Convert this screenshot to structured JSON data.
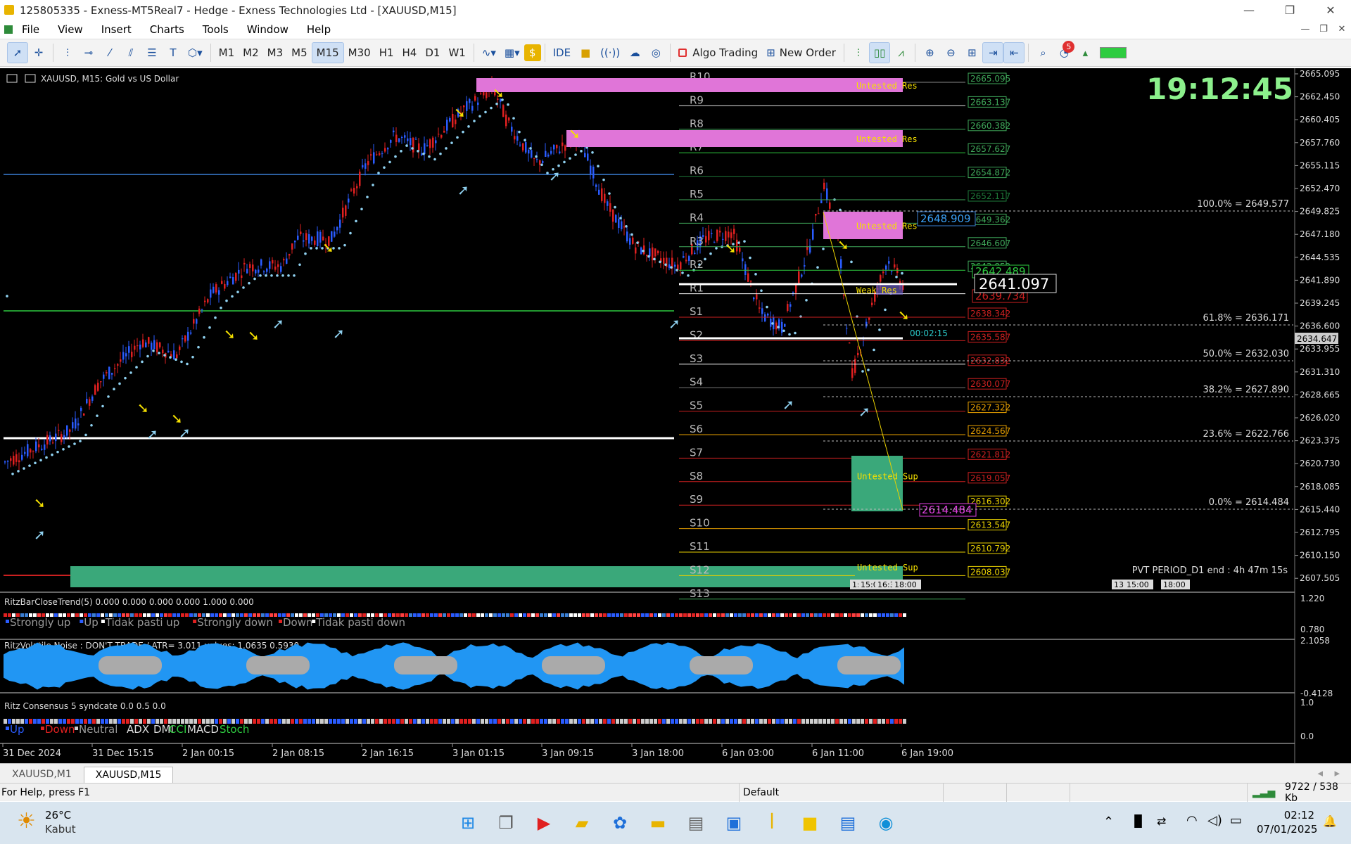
{
  "window": {
    "title": "125805335 - Exness-MT5Real7 - Hedge - Exness Technologies Ltd - [XAUUSD,M15]",
    "minimize": "—",
    "maximize": "❐",
    "close": "✕"
  },
  "menu": [
    "File",
    "View",
    "Insert",
    "Charts",
    "Tools",
    "Window",
    "Help"
  ],
  "toolbar": {
    "timeframes": [
      "M1",
      "M2",
      "M3",
      "M5",
      "M15",
      "M30",
      "H1",
      "H4",
      "D1",
      "W1"
    ],
    "active_timeframe": "M15",
    "ide": "IDE",
    "algo_trading": "Algo Trading",
    "new_order": "New Order",
    "notif_count": "5"
  },
  "chart": {
    "symbol_title": "XAUUSD, M15:  Gold vs US Dollar",
    "clock": "19:12:45",
    "current_price": "2641.097",
    "bid_price": "2634.647",
    "timer": "00:02:15",
    "price_labels": [
      "2665.095",
      "2663.137",
      "2660.382",
      "2657.627",
      "2654.872",
      "2652.117",
      "2649.362",
      "2646.607",
      "2643.852",
      "2641.097",
      "2638.342",
      "2635.587",
      "2632.832",
      "2630.077",
      "2627.322",
      "2624.567",
      "2621.812",
      "2619.057",
      "2616.302",
      "2613.547",
      "2610.792",
      "2608.037"
    ],
    "axis_prices": [
      "2665.095",
      "2662.450",
      "2660.405",
      "2657.760",
      "2655.115",
      "2652.470",
      "2649.825",
      "2647.180",
      "2644.535",
      "2641.890",
      "2639.245",
      "2636.600",
      "2633.955",
      "2631.310",
      "2628.665",
      "2626.020",
      "2623.375",
      "2620.730",
      "2618.085",
      "2615.440",
      "2612.795",
      "2610.150",
      "2607.505"
    ],
    "axis_highlight": "2634.647",
    "pivot_names": [
      "R10",
      "R9",
      "R8",
      "R7",
      "R6",
      "R5",
      "R4",
      "R3",
      "R2",
      "R1",
      "S1",
      "S2",
      "S3",
      "S4",
      "S5",
      "S6",
      "S7",
      "S8",
      "S9",
      "S10",
      "S11",
      "S12",
      "S13"
    ],
    "zones": [
      "Untested Res",
      "Untested Res",
      "Untested Res",
      "Weak Res",
      "Untested Sup",
      "Untested Sup"
    ],
    "labels": {
      "high": "2648.909",
      "mid": "2642.489",
      "lowred": "2639.734",
      "low": "2614.484"
    },
    "fib": [
      "100.0% = 2649.577",
      "61.8% = 2636.171",
      "50.0% = 2632.030",
      "38.2% = 2627.890",
      "23.6% = 2622.766",
      "0.0% = 2614.484"
    ],
    "pvt": "PVT PERIOD_D1 end : 4h 47m 15s",
    "time_tags": [
      "1:",
      "15:00",
      "16:3",
      "18:00",
      "13:3",
      "15:00",
      "18:00"
    ],
    "x_axis": [
      "31 Dec 2024",
      "31 Dec 15:15",
      "2 Jan 00:15",
      "2 Jan 08:15",
      "2 Jan 16:15",
      "3 Jan 01:15",
      "3 Jan 09:15",
      "3 Jan 18:00",
      "6 Jan 03:00",
      "6 Jan 11:00",
      "6 Jan 19:00"
    ]
  },
  "indicators": {
    "ind1": {
      "title": "RitzBarCloseTrend(5) 0.000 0.000 0.000 0.000 1.000 0.000",
      "legend": [
        "Strongly up",
        "Up",
        "Tidak pasti up",
        "Strongly down",
        "Down",
        "Tidak pasti down"
      ],
      "scale": [
        "1.220",
        "0.780"
      ]
    },
    "ind2": {
      "title": "RitzVolatile Noise : DON'T TRADE  /  ATR= 3.011    values: 1.0635 0.5930",
      "scale": [
        "2.1058",
        "-0.4128"
      ]
    },
    "ind3": {
      "title": "Ritz Consensus 5 syndcate 0.0 0.5 0.0",
      "legend": [
        "Up",
        "Down",
        "Neutral",
        "ADX",
        "DMI",
        "CCI",
        "MACD",
        "Stoch"
      ],
      "scale": [
        "1.0",
        "0.0"
      ]
    }
  },
  "tabs": [
    "XAUUSD,M1",
    "XAUUSD,M15"
  ],
  "status": {
    "help": "For Help, press F1",
    "profile": "Default",
    "traffic": "9722 / 538 Kb"
  },
  "taskbar": {
    "weather_temp": "26°C",
    "weather_desc": "Kabut",
    "time": "02:12",
    "date": "07/01/2025"
  },
  "colors": {
    "pivot_text": "#d8d8d8",
    "zone_res": "#e075d8",
    "zone_sup": "#3aa87a",
    "clock": "#8cf08c"
  }
}
